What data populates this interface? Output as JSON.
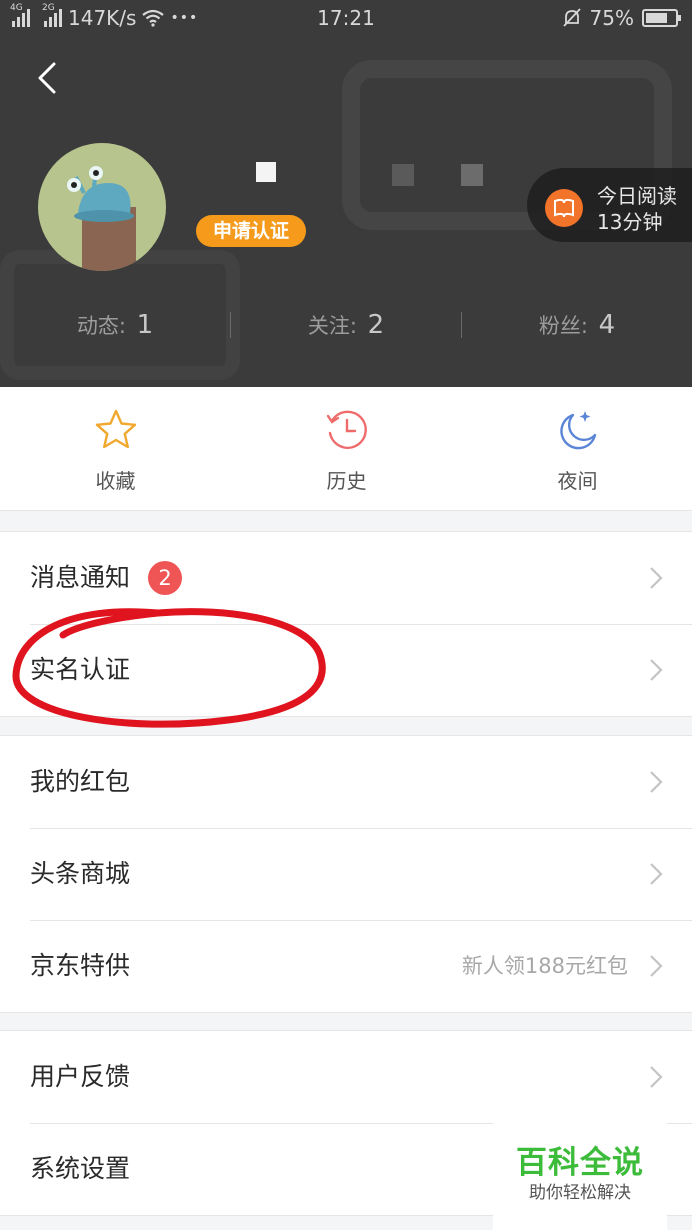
{
  "status_bar": {
    "net_speed": "147K/s",
    "time": "17:21",
    "battery": "75%",
    "battery_fraction": 0.75,
    "sig1": "4G",
    "sig2": "2G",
    "dots": "•••"
  },
  "profile": {
    "cert_button": "申请认证",
    "reading_line1": "今日阅读",
    "reading_line2": "13分钟"
  },
  "stats": [
    {
      "label": "动态: ",
      "value": "1"
    },
    {
      "label": "关注: ",
      "value": "2"
    },
    {
      "label": "粉丝: ",
      "value": "4"
    }
  ],
  "quick_actions": [
    {
      "label": "收藏",
      "icon": "star-icon"
    },
    {
      "label": "历史",
      "icon": "history-clock-icon"
    },
    {
      "label": "夜间",
      "icon": "moon-icon"
    }
  ],
  "menu": {
    "group1": [
      {
        "label": "消息通知",
        "badge": "2"
      },
      {
        "label": "实名认证"
      }
    ],
    "group2": [
      {
        "label": "我的红包"
      },
      {
        "label": "头条商城"
      },
      {
        "label": "京东特供",
        "sub": "新人领188元红包"
      }
    ],
    "group3": [
      {
        "label": "用户反馈"
      },
      {
        "label": "系统设置"
      }
    ]
  },
  "watermark": {
    "title": "百科全说",
    "subtitle": "助你轻松解决"
  },
  "colors": {
    "header_bg": "#3b3b3b",
    "accent_orange": "#f59a1b",
    "badge_red": "#f05555",
    "annotation_red": "#e0141e",
    "watermark_green": "#3dbb3a"
  }
}
